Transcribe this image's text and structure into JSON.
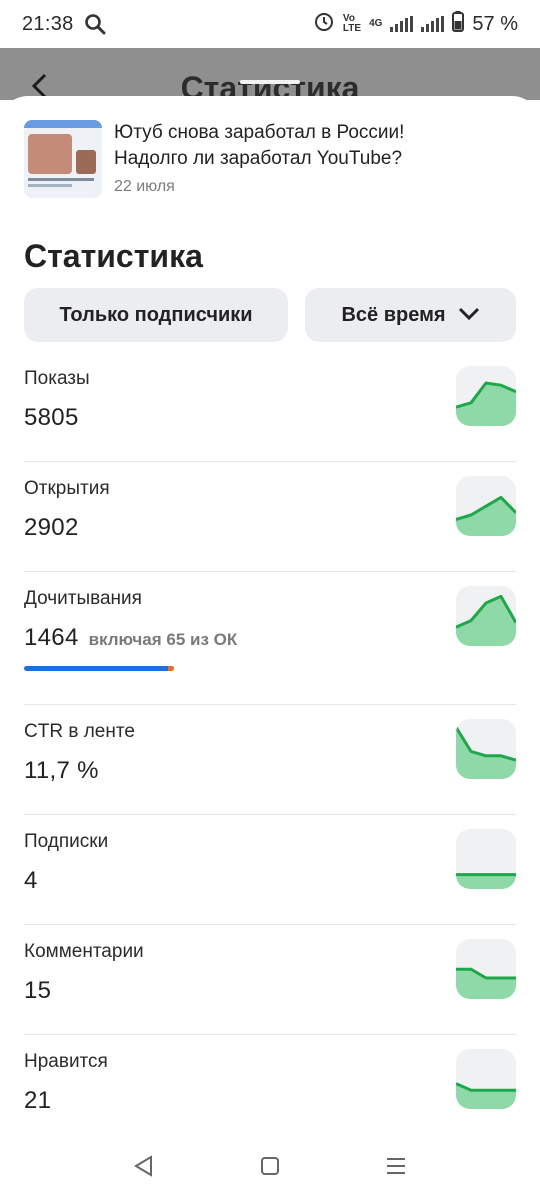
{
  "status_bar": {
    "time": "21:38",
    "network_top": "Vo",
    "network_bottom": "LTE",
    "network_gen": "4G",
    "battery": "57 %"
  },
  "background": {
    "title": "Статистика"
  },
  "article": {
    "title": "Ютуб снова заработал в России! Надолго ли заработал YouTube?",
    "date": "22 июля"
  },
  "heading": "Статистика",
  "filters": {
    "audience": "Только подписчики",
    "period": "Всё время"
  },
  "stats": [
    {
      "label": "Показы",
      "value": "5805",
      "trend": [
        0.2,
        0.3,
        0.75,
        0.7,
        0.55
      ]
    },
    {
      "label": "Открытия",
      "value": "2902",
      "trend": [
        0.15,
        0.25,
        0.45,
        0.65,
        0.3
      ]
    },
    {
      "label": "Дочитывания",
      "value": "1464",
      "note": "включая 65 из ОК",
      "progress": 0.96,
      "progress_ok": 0.04,
      "trend": [
        0.2,
        0.35,
        0.75,
        0.9,
        0.3
      ]
    },
    {
      "label": "CTR в ленте",
      "value": "11,7 %",
      "trend": [
        0.95,
        0.4,
        0.3,
        0.3,
        0.2
      ]
    },
    {
      "label": "Подписки",
      "value": "4",
      "trend": [
        0.1,
        0.1,
        0.1,
        0.1,
        0.1
      ]
    },
    {
      "label": "Комментарии",
      "value": "15",
      "trend": [
        0.45,
        0.45,
        0.25,
        0.25,
        0.25
      ]
    },
    {
      "label": "Нравится",
      "value": "21",
      "trend": [
        0.35,
        0.2,
        0.2,
        0.2,
        0.2
      ]
    }
  ],
  "colors": {
    "accent": "#1d6fe0",
    "ok_orange": "#f46b1f",
    "spark_line": "#1fa84a",
    "spark_fill": "#8fd9a8"
  }
}
